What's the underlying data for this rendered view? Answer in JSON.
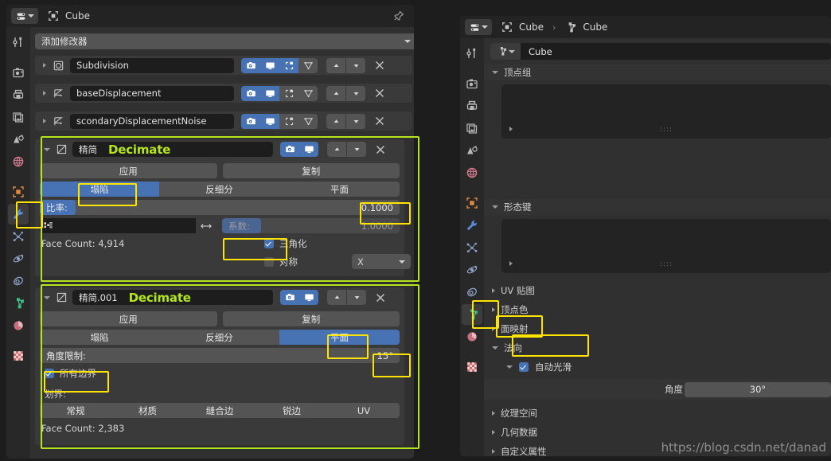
{
  "left_editor": {
    "header": {
      "editor_type": "properties-editor-icon",
      "breadcrumb_object_icon": "object-icon",
      "breadcrumb_object": "Cube",
      "pin_icon": "pin-icon"
    },
    "navbar_icons": [
      "tool-icon",
      "render-icon",
      "output-icon",
      "view-layer-icon",
      "scene-icon",
      "world-icon",
      "object-icon",
      "modifier-wrench-icon",
      "particles-icon",
      "physics-icon",
      "constraints-icon",
      "data-mesh-icon",
      "material-icon",
      "texture-icon"
    ],
    "navbar_selected_index": 7,
    "add_modifier_label": "添加修改器",
    "modifiers": [
      {
        "name": "Subdivision",
        "icon": "subdivision-icon",
        "expanded": false,
        "toggles": [
          "render-on",
          "realtime-on",
          "editmode-on",
          "oncage-off"
        ]
      },
      {
        "name": "baseDisplacement",
        "icon": "displace-icon",
        "expanded": false,
        "toggles": [
          "render-on",
          "realtime-on",
          "editmode-off",
          "oncage-off"
        ]
      },
      {
        "name": "scondaryDisplacementNoise",
        "icon": "displace-icon",
        "expanded": false,
        "toggles": [
          "render-on",
          "realtime-on",
          "editmode-off",
          "oncage-off"
        ]
      }
    ],
    "decimate1": {
      "name": "精简",
      "type_label": "Decimate",
      "icon": "decimate-icon",
      "apply_label": "应用",
      "duplicate_label": "复制",
      "modes": [
        "塌陷",
        "反细分",
        "平面"
      ],
      "active_mode": "塌陷",
      "ratio_label": "比率:",
      "ratio_value": "0.1000",
      "ratio_fill_pct": 10,
      "vertex_group_placeholder": "",
      "vertex_group_icon": "vertex-group-icon",
      "invert_icon": "arrows-lr-icon",
      "factor_label": "系数:",
      "factor_value": "1.0000",
      "face_count": "Face Count: 4,914",
      "triangulate_label": "三角化",
      "triangulate_checked": true,
      "symmetry_label": "对称",
      "symmetry_checked": false,
      "symmetry_axis": "X"
    },
    "decimate2": {
      "name": "精简.001",
      "type_label": "Decimate",
      "icon": "decimate-icon",
      "apply_label": "应用",
      "duplicate_label": "复制",
      "modes": [
        "塌陷",
        "反细分",
        "平面"
      ],
      "active_mode": "平面",
      "angle_limit_label": "角度限制:",
      "angle_limit_value": "15°",
      "all_boundaries_label": "所有边界",
      "all_boundaries_checked": true,
      "delimit_label": "划界:",
      "delimit_options": [
        "常规",
        "材质",
        "缝合边",
        "锐边",
        "UV"
      ],
      "face_count": "Face Count: 2,383"
    }
  },
  "right_editor": {
    "header": {
      "editor_type": "properties-editor-icon",
      "breadcrumb_object_icon": "object-icon",
      "breadcrumb_object": "Cube",
      "breadcrumb_sep": "›",
      "breadcrumb_data_icon": "data-mesh-icon",
      "breadcrumb_data": "Cube"
    },
    "navbar_icons": [
      "tool-icon",
      "render-icon",
      "output-icon",
      "view-layer-icon",
      "scene-icon",
      "world-icon",
      "object-icon",
      "modifier-wrench-icon",
      "particles-icon",
      "physics-icon",
      "constraints-icon",
      "data-mesh-icon",
      "material-icon",
      "texture-icon"
    ],
    "navbar_selected_index": 11,
    "datablock_icon": "data-mesh-icon",
    "datablock_name": "Cube",
    "sections": [
      {
        "label": "顶点组",
        "expanded": true,
        "has_list": true
      },
      {
        "label": "形态键",
        "expanded": true,
        "has_list": true
      },
      {
        "label": "UV 贴图",
        "expanded": false,
        "has_list": false
      },
      {
        "label": "顶点色",
        "expanded": false,
        "has_list": false
      },
      {
        "label": "面映射",
        "expanded": false,
        "has_list": false
      },
      {
        "label": "法向",
        "expanded": true,
        "has_list": false
      },
      {
        "label": "纹理空间",
        "expanded": false,
        "has_list": false
      },
      {
        "label": "几何数据",
        "expanded": false,
        "has_list": false
      },
      {
        "label": "自定义属性",
        "expanded": false,
        "has_list": false
      }
    ],
    "auto_smooth_label": "自动光滑",
    "auto_smooth_checked": true,
    "angle_label": "角度",
    "angle_value": "30°"
  },
  "watermark": "https://blog.csdn.net/danad",
  "colors": {
    "accent_blue": "#4772b3",
    "highlight_yellow": "#ffe400",
    "highlight_green": "#b5e61d",
    "panel_bg": "#303030",
    "header_bg": "#232323"
  }
}
